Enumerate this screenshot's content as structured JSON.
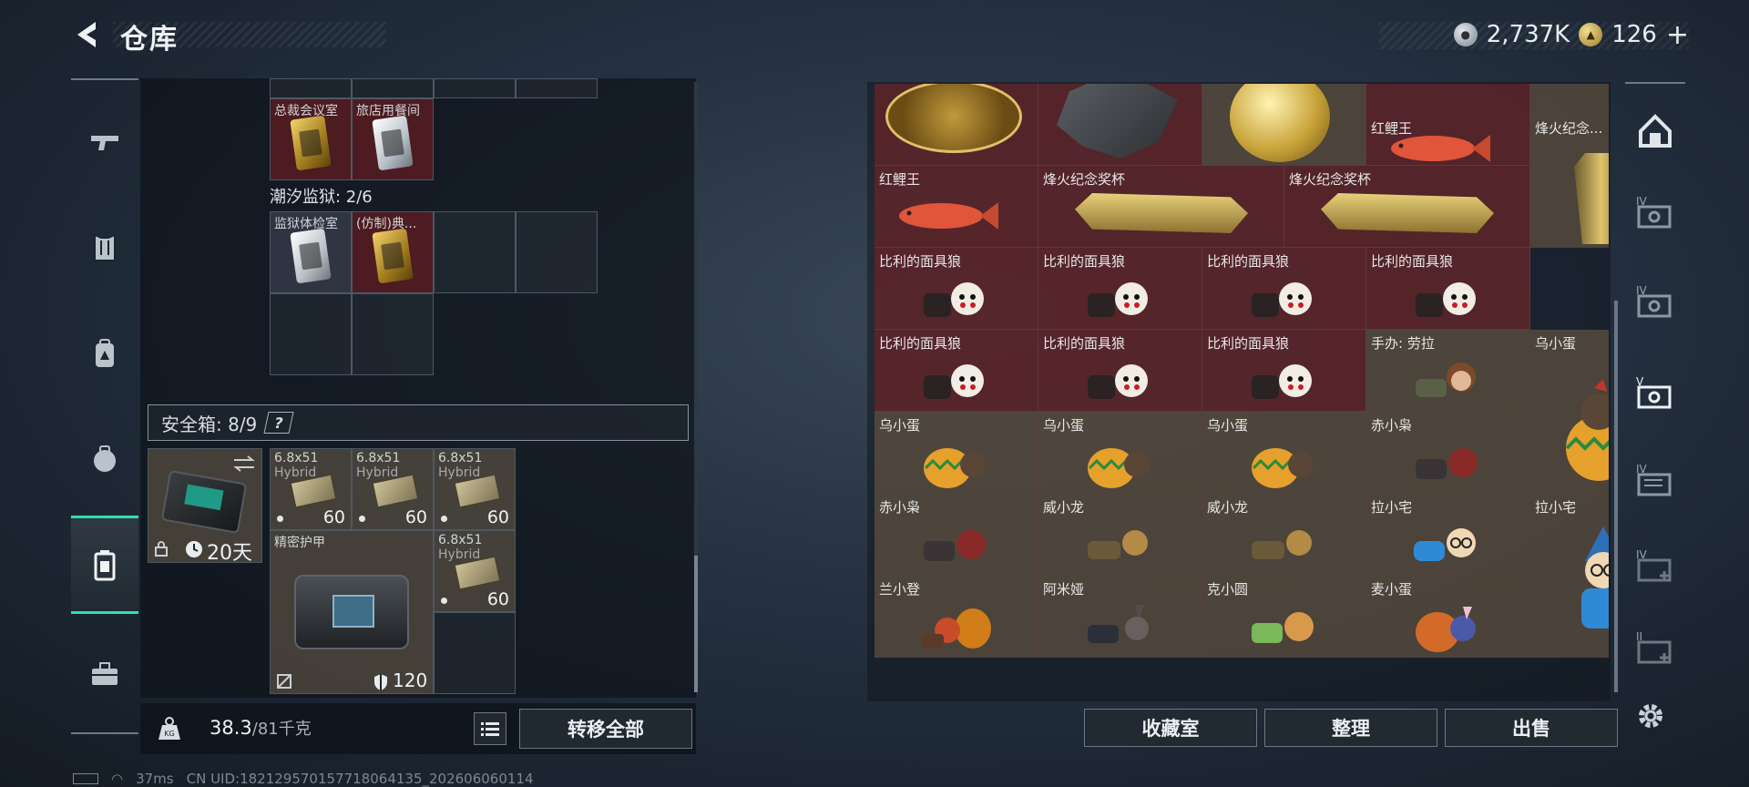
{
  "header": {
    "title": "仓库",
    "silver_amount": "2,737K",
    "gold_amount": "126",
    "gold_plus": "+"
  },
  "left_nav": {
    "items": [
      "gun-icon",
      "vest-icon",
      "backpack-icon",
      "bag-icon",
      "case-icon",
      "toolbox-icon"
    ],
    "active_index": 4
  },
  "keys": {
    "top_labels": [
      "总裁会议室",
      "旅店用餐间"
    ],
    "prison_title": "潮汐监狱: 2/6",
    "prison_labels": [
      "监狱体检室",
      "(仿制)典..."
    ]
  },
  "safe_box": {
    "label": "安全箱: 8/9",
    "help": "?",
    "days": "20天",
    "items": [
      {
        "name": "6.8x51",
        "sub": "Hybrid",
        "count": "60"
      },
      {
        "name": "6.8x51",
        "sub": "Hybrid",
        "count": "60"
      },
      {
        "name": "6.8x51",
        "sub": "Hybrid",
        "count": "60"
      },
      {
        "name": "6.8x51",
        "sub": "Hybrid",
        "count": "60"
      }
    ],
    "armor_name": "精密护甲",
    "armor_durability": "120"
  },
  "footer_left": {
    "weight_value": "38.3",
    "weight_max": "/81千克",
    "transfer_all": "转移全部"
  },
  "right_grid": {
    "labels": {
      "r0c3": "红鲤王",
      "r0c4": "烽火纪念...",
      "r1c0": "红鲤王",
      "r1c1": "烽火纪念奖杯",
      "r1c2": "烽火纪念奖杯",
      "r2": [
        "比利的面具狼",
        "比利的面具狼",
        "比利的面具狼",
        "比利的面具狼"
      ],
      "r3": [
        "比利的面具狼",
        "比利的面具狼",
        "比利的面具狼",
        "手办: 劳拉",
        "乌小蛋"
      ],
      "r4": [
        "乌小蛋",
        "乌小蛋",
        "乌小蛋",
        "赤小枭"
      ],
      "r5": [
        "赤小枭",
        "威小龙",
        "威小龙",
        "拉小宅",
        "拉小宅"
      ],
      "r6": [
        "兰小登",
        "阿米娅",
        "克小圆",
        "麦小蛋"
      ]
    }
  },
  "bottom_buttons": {
    "collection": "收藏室",
    "sort": "整理",
    "sell": "出售"
  },
  "right_nav": {
    "tier_labels": [
      "IV",
      "IV",
      "V",
      "IV",
      "IV",
      "II"
    ]
  },
  "status": {
    "ping": "37ms",
    "uid": "CN UID:182129570157718064135_202606060114"
  },
  "colors": {
    "accent": "#2ee0b0",
    "cell_red": "#60262a",
    "cell_tan": "#625240"
  }
}
